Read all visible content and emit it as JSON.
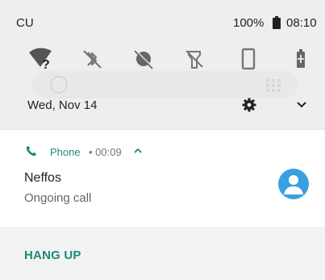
{
  "status_bar": {
    "carrier": "CU",
    "battery_percent": "100%",
    "time": "08:10",
    "battery_icon": "battery-full-icon"
  },
  "quick_settings": {
    "tiles": [
      {
        "icon": "wifi-unknown-icon",
        "label_glyph": "?"
      },
      {
        "icon": "bluetooth-off-icon"
      },
      {
        "icon": "do-not-disturb-off-icon"
      },
      {
        "icon": "flashlight-off-icon"
      },
      {
        "icon": "auto-rotate-icon"
      },
      {
        "icon": "battery-saver-icon"
      }
    ],
    "date": "Wed, Nov 14",
    "settings_icon": "gear-icon",
    "expand_icon": "chevron-down-icon"
  },
  "notification": {
    "app_icon": "phone-icon",
    "app_name": "Phone",
    "meta": "• 00:09",
    "expand_icon": "chevron-up-icon",
    "title": "Neffos",
    "text": "Ongoing call",
    "avatar_icon": "person-avatar-icon",
    "action_label": "HANG UP"
  },
  "colors": {
    "accent": "#1a8a7a",
    "avatar": "#3a9fe0",
    "panel_bg": "#eeeeee"
  }
}
